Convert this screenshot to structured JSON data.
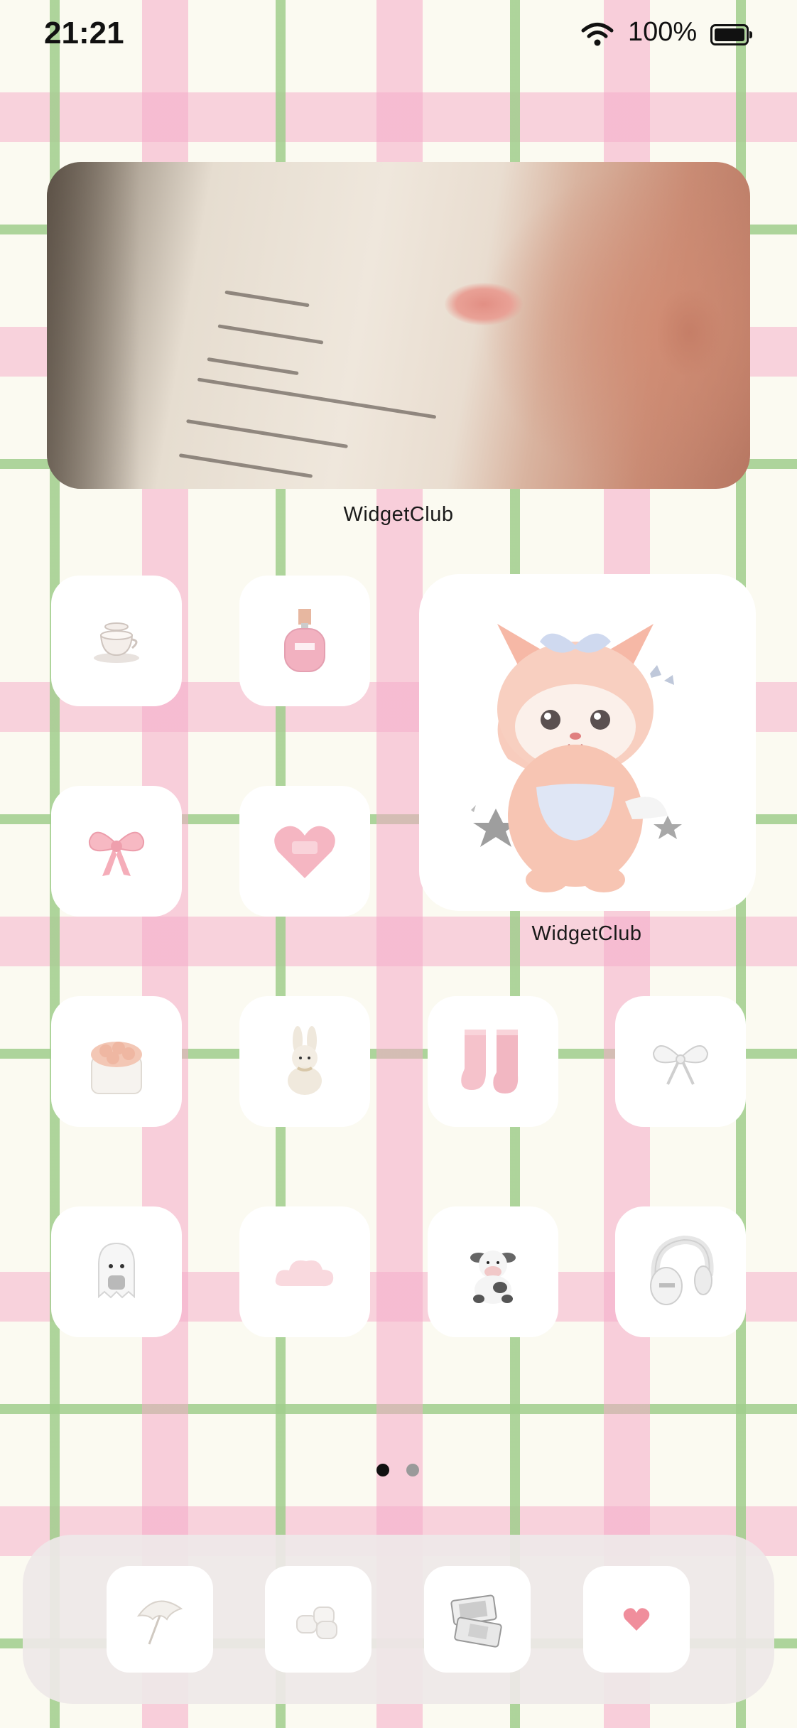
{
  "status_bar": {
    "time": "21:21",
    "battery_text": "100%"
  },
  "widgets": {
    "photo_widget_label": "WidgetClub",
    "character_widget_label": "WidgetClub"
  },
  "apps": [
    {
      "icon": "teacup-icon"
    },
    {
      "icon": "perfume-icon"
    },
    {
      "icon": "pink-bow-icon"
    },
    {
      "icon": "heart-icon"
    },
    {
      "icon": "rose-box-icon"
    },
    {
      "icon": "bunny-plush-icon"
    },
    {
      "icon": "socks-icon"
    },
    {
      "icon": "white-ribbon-icon"
    },
    {
      "icon": "ghost-icon"
    },
    {
      "icon": "cloud-icon"
    },
    {
      "icon": "cow-plush-icon"
    },
    {
      "icon": "headphones-icon"
    }
  ],
  "page_indicator": {
    "pages": 2,
    "current": 1
  },
  "dock": [
    {
      "icon": "umbrella-icon"
    },
    {
      "icon": "marshmallow-icon"
    },
    {
      "icon": "game-console-icon"
    },
    {
      "icon": "small-heart-icon"
    }
  ],
  "colors": {
    "pink": "#f3b7c6",
    "green": "#a3cf8c",
    "background": "#fbfaf1"
  }
}
